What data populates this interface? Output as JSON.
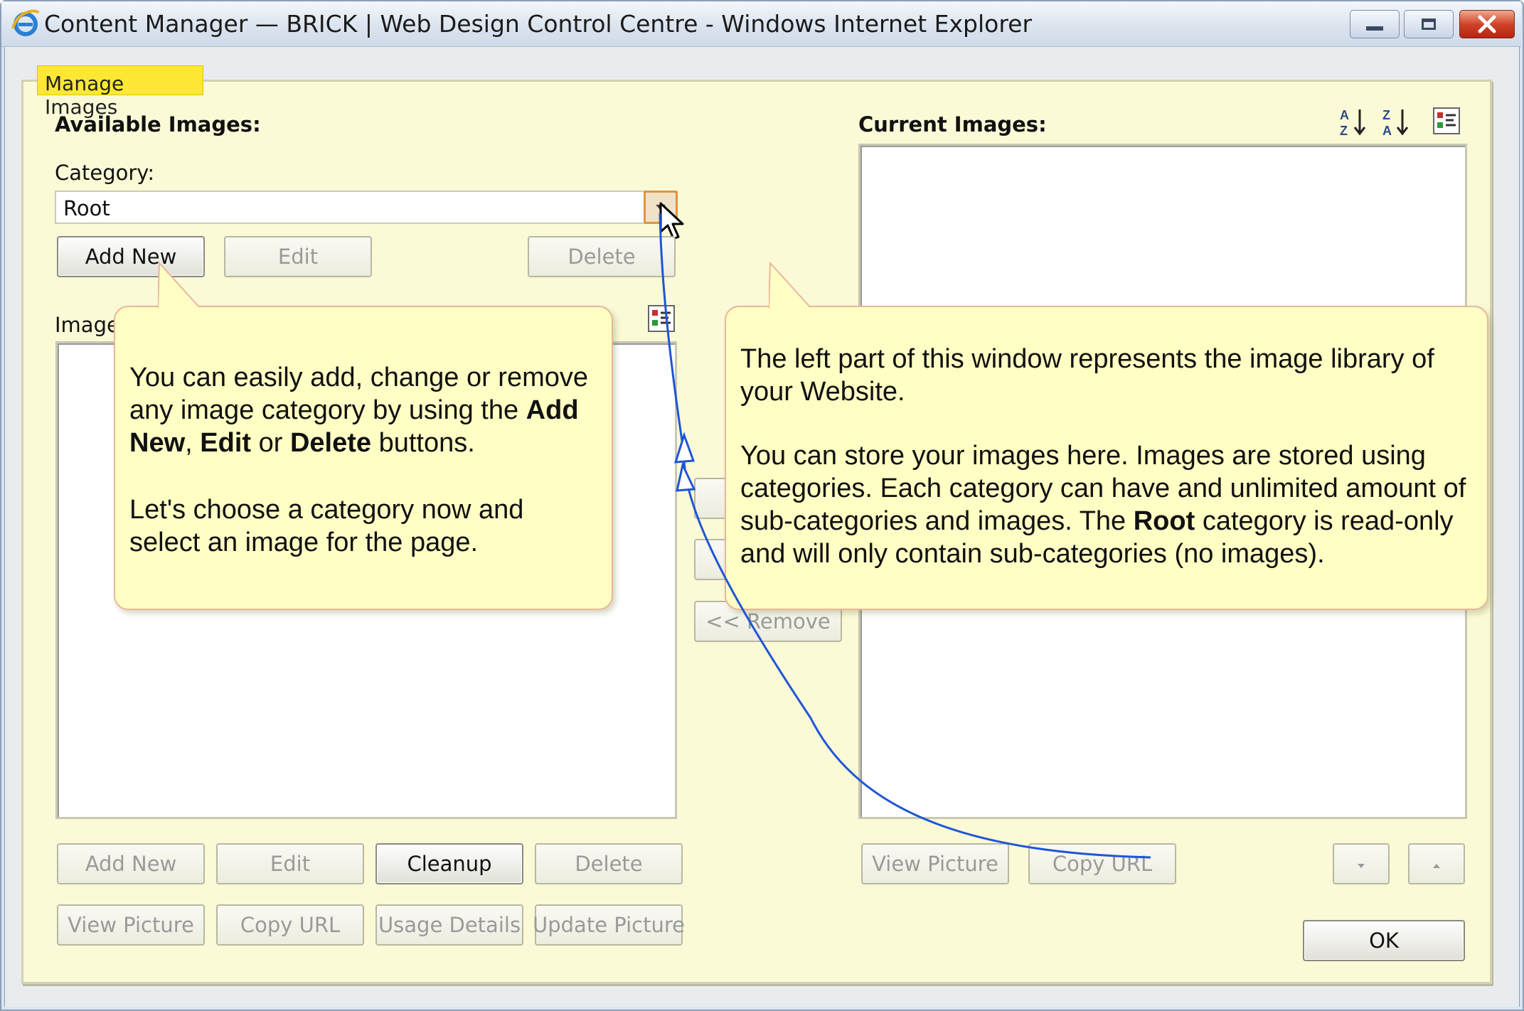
{
  "window": {
    "title": "Content Manager — BRICK | Web Design Control Centre - Windows Internet Explorer",
    "controls": [
      "minimize",
      "maximize",
      "close"
    ]
  },
  "panel": {
    "tab_label": "Manage Images"
  },
  "available": {
    "heading": "Available Images:",
    "category_label": "Category:",
    "category_value": "Root",
    "category_buttons": {
      "add_new": "Add New",
      "edit": "Edit",
      "delete": "Delete"
    },
    "images_label": "Images",
    "bottom_buttons_row1": {
      "add_new": "Add New",
      "edit": "Edit",
      "cleanup": "Cleanup",
      "delete": "Delete"
    },
    "bottom_buttons_row2": {
      "view_picture": "View Picture",
      "copy_url": "Copy URL",
      "usage_details": "Usage Details",
      "update_picture": "Update Picture"
    }
  },
  "middle": {
    "remove_label": "<< Remove"
  },
  "current": {
    "heading": "Current Images:",
    "view_picture": "View Picture",
    "copy_url": "Copy URL",
    "ok": "OK"
  },
  "icons": {
    "sort_az": "sort-ascending-icon",
    "sort_za": "sort-descending-icon",
    "view_options": "view-options-icon",
    "move_down": "move-down-icon",
    "move_up": "move-up-icon",
    "ie_logo": "ie-logo-icon",
    "cursor": "mouse-pointer-icon"
  },
  "callouts": {
    "left": {
      "p1_a": "You can easily add, change or remove any image category by using the ",
      "p1_b1": "Add New",
      "p1_sep1": ", ",
      "p1_b2": "Edit",
      "p1_sep2": " or ",
      "p1_b3": "Delete",
      "p1_end": " buttons.",
      "p2": "Let's choose a category now and select an image for the page."
    },
    "right": {
      "p1": "The left part of this window represents the image library of your Website.",
      "p2_a": " You can store your images here. Images are stored using categories. Each category can have and unlimited amount of sub-categories and images. The ",
      "p2_b": "Root",
      "p2_end": " category is read-only and will only contain sub-categories (no images)."
    }
  },
  "colors": {
    "panel_bg": "#fafad7",
    "tab_bg": "#ffe833",
    "callout_bg": "#fffec4",
    "callout_border": "#e9b79b",
    "arrow": "#1f55d6"
  }
}
